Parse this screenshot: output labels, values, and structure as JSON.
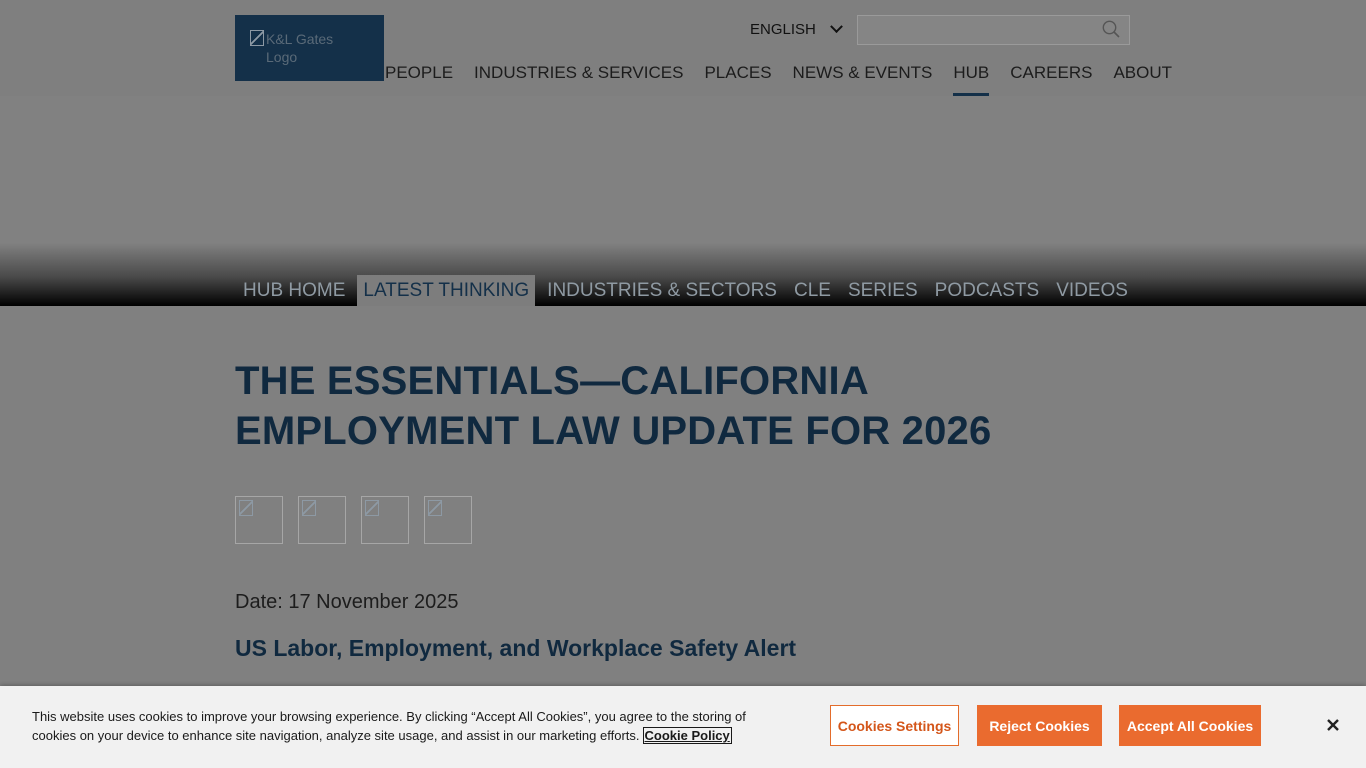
{
  "header": {
    "logo_alt": "K&L Gates Logo",
    "language": "ENGLISH",
    "search": {
      "placeholder": "",
      "value": ""
    },
    "nav": [
      "PEOPLE",
      "INDUSTRIES & SERVICES",
      "PLACES",
      "NEWS & EVENTS",
      "HUB",
      "CAREERS",
      "ABOUT"
    ],
    "active_nav": "HUB"
  },
  "hub_nav": {
    "items": [
      "HUB HOME",
      "LATEST THINKING",
      "INDUSTRIES & SECTORS",
      "CLE",
      "SERIES",
      "PODCASTS",
      "VIDEOS"
    ],
    "active": "LATEST THINKING"
  },
  "article": {
    "title": "THE ESSENTIALS—CALIFORNIA EMPLOYMENT LAW UPDATE FOR 2026",
    "date": "Date: 17 November 2025",
    "alert_type": "US Labor, Employment, and Workplace Safety Alert",
    "share_buttons": [
      "share-icon-1",
      "share-icon-2",
      "share-icon-3",
      "share-icon-4"
    ]
  },
  "cookie_banner": {
    "text": "This website uses cookies to improve your browsing experience. By clicking “Accept All Cookies”, you agree to the storing of cookies on your device to enhance site navigation, analyze site usage, and assist in our marketing efforts.",
    "policy_link": "Cookie Policy",
    "settings_label": "Cookies Settings",
    "reject_label": "Reject Cookies",
    "accept_label": "Accept All Cookies"
  },
  "colors": {
    "brand_navy": "#143049",
    "cookie_orange": "#ea6b2f"
  }
}
